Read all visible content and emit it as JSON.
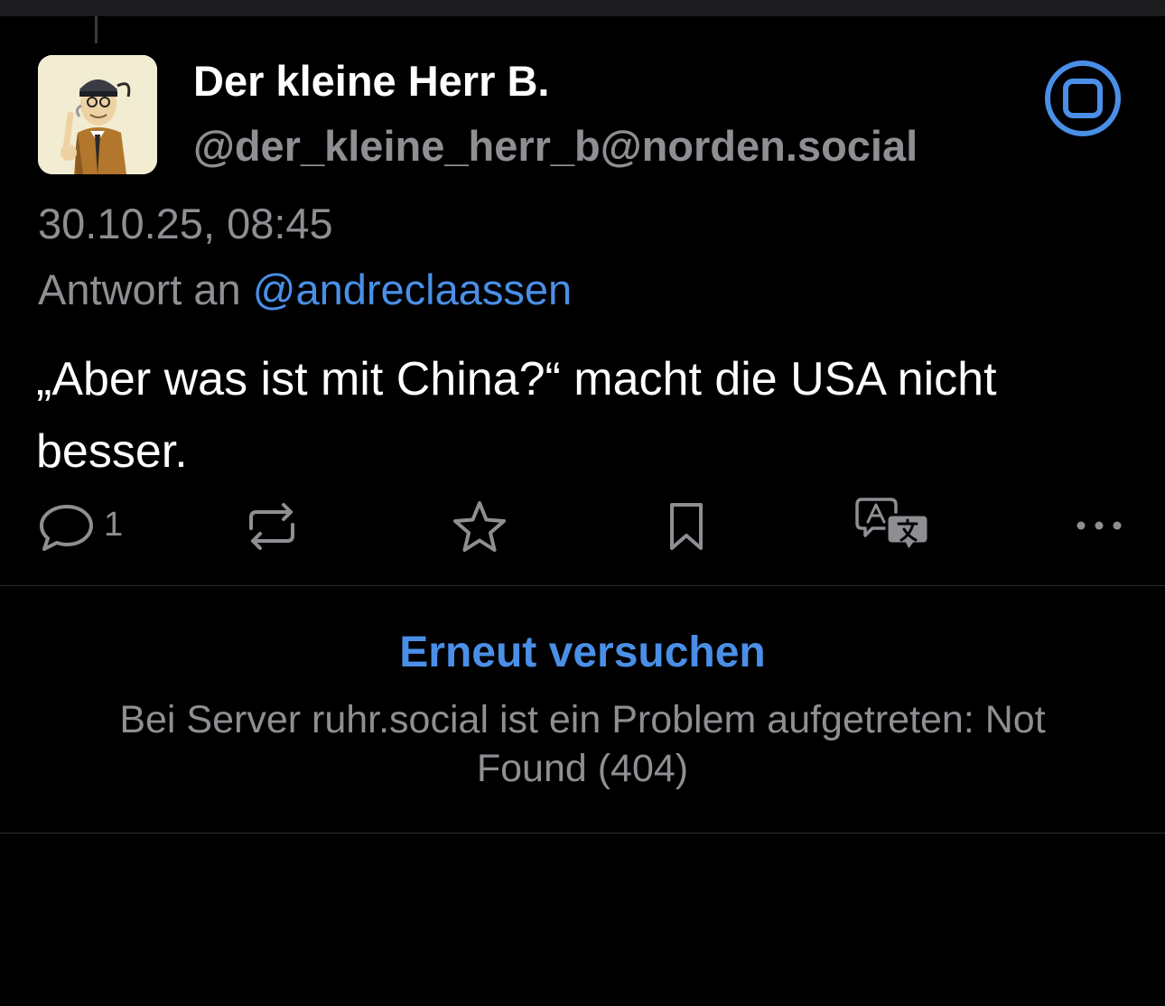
{
  "post": {
    "display_name": "Der kleine Herr B.",
    "handle": "@der_kleine_herr_b@norden.social",
    "timestamp": "30.10.25, 08:45",
    "reply_prefix": "Antwort an",
    "reply_mention": "@andreclaassen",
    "text": "„Aber was ist mit China?“ macht die USA nicht besser.",
    "reply_count": "1"
  },
  "icons": {
    "badge": "bot-badge-icon",
    "reply": "speech-bubble-icon",
    "boost": "repost-arrows-icon",
    "favorite": "star-icon",
    "bookmark": "bookmark-icon",
    "translate": "translate-icon",
    "more": "ellipsis-icon"
  },
  "error": {
    "retry_label": "Erneut versuchen",
    "message": "Bei Server ruhr.social ist ein Problem aufgetreten: Not Found (404)"
  },
  "colors": {
    "background": "#000000",
    "accent": "#4a8fe7",
    "secondary_text": "#8e8e93",
    "primary_text": "#ffffff"
  }
}
